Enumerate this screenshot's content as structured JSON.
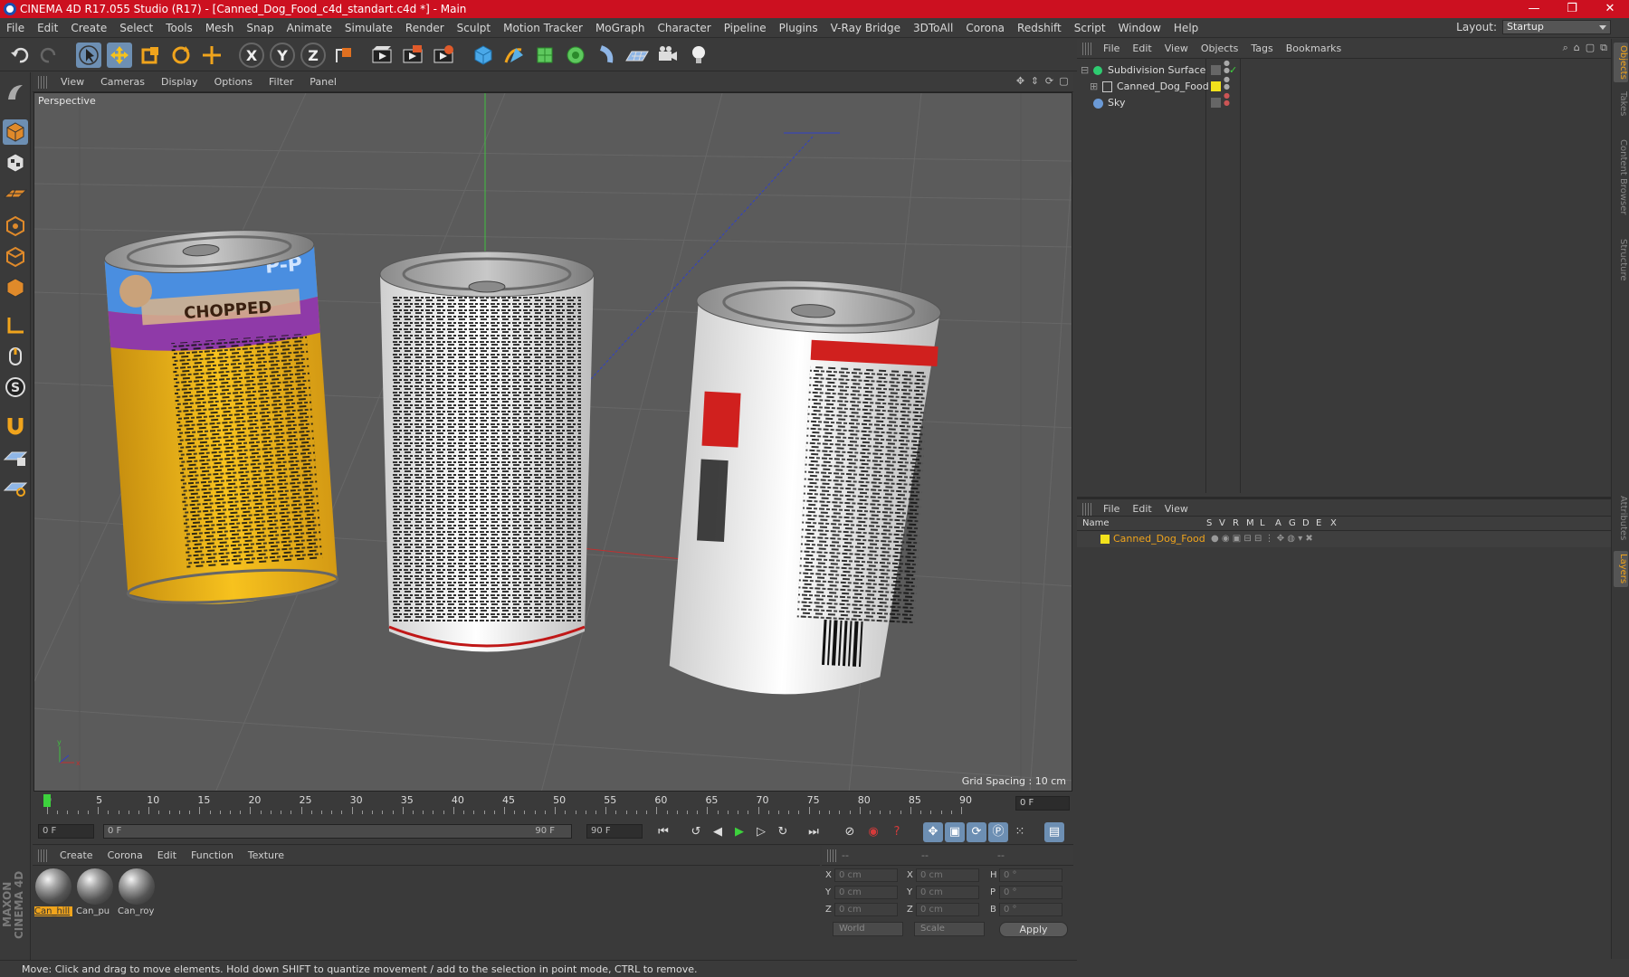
{
  "window": {
    "title": "CINEMA 4D R17.055 Studio (R17) - [Canned_Dog_Food_c4d_standart.c4d *] - Main",
    "controls": [
      "—",
      "❐",
      "✕"
    ]
  },
  "menubar": {
    "items": [
      "File",
      "Edit",
      "Create",
      "Select",
      "Tools",
      "Mesh",
      "Snap",
      "Animate",
      "Simulate",
      "Render",
      "Sculpt",
      "Motion Tracker",
      "MoGraph",
      "Character",
      "Pipeline",
      "Plugins",
      "V-Ray Bridge",
      "3DToAll",
      "Corona",
      "Redshift",
      "Script",
      "Window",
      "Help"
    ],
    "layout_label": "Layout:",
    "layout_value": "Startup"
  },
  "toolbar": {
    "icons": [
      "undo-icon",
      "redo-icon",
      "select-arrow-icon",
      "move-icon",
      "scale-icon",
      "rotate-icon",
      "live-selection-icon",
      "x-axis-icon",
      "y-axis-icon",
      "z-axis-icon",
      "coordinate-system-icon",
      "render-view-icon",
      "render-picture-viewer-icon",
      "edit-render-settings-icon",
      "cube-icon",
      "pen-icon",
      "subdivision-icon",
      "cloner-icon",
      "deformer-icon",
      "floor-icon",
      "camera-icon",
      "light-icon"
    ],
    "axis_labels": [
      "X",
      "Y",
      "Z"
    ]
  },
  "viewport": {
    "menu": [
      "View",
      "Cameras",
      "Display",
      "Options",
      "Filter",
      "Panel"
    ],
    "label": "Perspective",
    "grid_spacing": "Grid Spacing : 10 cm",
    "cans": [
      {
        "name": "can-blue-yellow",
        "label_text": "CHOPPED",
        "brand_text": "P-P"
      },
      {
        "name": "can-white-text"
      },
      {
        "name": "can-white-red"
      }
    ]
  },
  "timeline": {
    "ticks": [
      "0",
      "5",
      "10",
      "15",
      "20",
      "25",
      "30",
      "35",
      "40",
      "45",
      "50",
      "55",
      "60",
      "65",
      "70",
      "75",
      "80",
      "85",
      "90"
    ],
    "current_frame": "0 F",
    "start_frame": "0 F",
    "range_start": "0 F",
    "range_end": "90 F",
    "end_frame": "90 F"
  },
  "materials": {
    "menu": [
      "Create",
      "Corona",
      "Edit",
      "Function",
      "Texture"
    ],
    "items": [
      "Can_hill",
      "Can_pu",
      "Can_roy"
    ]
  },
  "coordinates": {
    "headers": [
      "--",
      "--",
      "--"
    ],
    "rows": [
      {
        "a": "X",
        "av": "0 cm",
        "b": "X",
        "bv": "0 cm",
        "c": "H",
        "cv": "0 °"
      },
      {
        "a": "Y",
        "av": "0 cm",
        "b": "Y",
        "bv": "0 cm",
        "c": "P",
        "cv": "0 °"
      },
      {
        "a": "Z",
        "av": "0 cm",
        "b": "Z",
        "bv": "0 cm",
        "c": "B",
        "cv": "0 °"
      }
    ],
    "space": "World",
    "mode": "Scale",
    "apply": "Apply"
  },
  "status": "Move: Click and drag to move elements. Hold down SHIFT to quantize movement / add to the selection in point mode, CTRL to remove.",
  "object_manager": {
    "menu": [
      "File",
      "Edit",
      "View",
      "Objects",
      "Tags",
      "Bookmarks"
    ],
    "objects": [
      {
        "name": "Subdivision Surface",
        "color": "#2ecc71"
      },
      {
        "name": "Canned_Dog_Food",
        "color": "#f2e21c"
      },
      {
        "name": "Sky",
        "color": "#6b9ad6"
      }
    ]
  },
  "layer_manager": {
    "menu": [
      "File",
      "Edit",
      "View"
    ],
    "columns": [
      "Name",
      "S",
      "V",
      "R",
      "M",
      "L",
      "A",
      "G",
      "D",
      "E",
      "X"
    ],
    "layers": [
      {
        "name": "Canned_Dog_Food",
        "color": "#f2e21c"
      }
    ]
  },
  "right_tabs": [
    "Objects",
    "Takes",
    "Content Browser",
    "Structure",
    "Attributes",
    "Layers"
  ],
  "branding": "MAXON CINEMA 4D",
  "colors": {
    "accent": "#f0a41c",
    "title_bar": "#cc1020",
    "active_tool": "#6d8fb3"
  }
}
